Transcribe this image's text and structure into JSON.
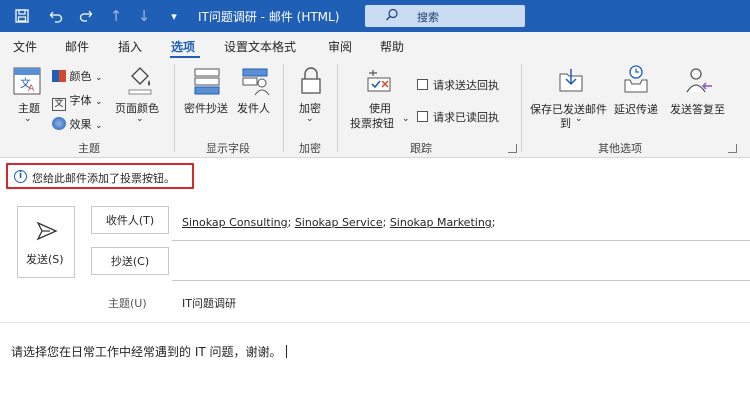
{
  "titlebar": {
    "title": "IT问题调研  -  邮件 (HTML)",
    "search_label": "搜索"
  },
  "menu": {
    "items": [
      "文件",
      "邮件",
      "插入",
      "选项",
      "设置文本格式",
      "审阅",
      "帮助"
    ],
    "active": "选项"
  },
  "ribbon": {
    "theme_group": {
      "theme": "主题",
      "colors": "颜色",
      "fonts": "字体",
      "effects": "效果",
      "page_color": "页面颜色",
      "label": "主题"
    },
    "fields_group": {
      "bcc": "密件抄送",
      "from": "发件人",
      "label": "显示字段"
    },
    "encrypt_group": {
      "encrypt": "加密",
      "label": "加密"
    },
    "tracking_group": {
      "voting_line1": "使用",
      "voting_line2": "投票按钮",
      "delivery_receipt": "请求送达回执",
      "read_receipt": "请求已读回执",
      "label": "跟踪"
    },
    "more_group": {
      "save_sent_line1": "保存已发送邮件",
      "save_sent_line2": "到",
      "delay": "延迟传递",
      "direct_replies": "发送答复至",
      "label": "其他选项"
    }
  },
  "infobar": {
    "text": "您给此邮件添加了投票按钮。"
  },
  "compose": {
    "send": "发送(S)",
    "to_button": "收件人(T)",
    "cc_button": "抄送(C)",
    "recipients": [
      "Sinokap Consulting",
      "Sinokap Service",
      "Sinokap Marketing"
    ],
    "subject_label": "主题(U)",
    "subject_value": "IT问题调研",
    "body": "请选择您在日常工作中经常遇到的 IT 问题，谢谢。"
  },
  "colors": {
    "titlebar": "#1f5fb6",
    "highlight": "#d6282c",
    "ribbon_bg": "#f3f3f3"
  }
}
